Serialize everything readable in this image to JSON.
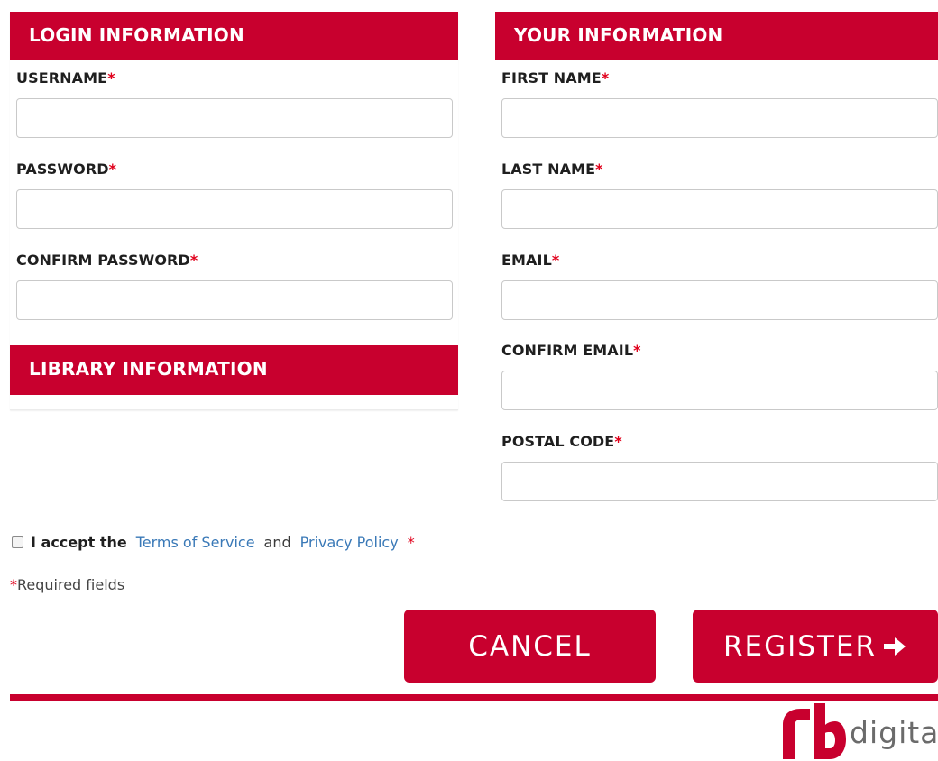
{
  "login": {
    "header": "LOGIN INFORMATION",
    "fields": [
      {
        "label": "USERNAME",
        "required_mark": "*",
        "value": ""
      },
      {
        "label": "PASSWORD",
        "required_mark": "*",
        "value": ""
      },
      {
        "label": "CONFIRM PASSWORD",
        "required_mark": "*",
        "value": ""
      }
    ]
  },
  "library": {
    "header": "LIBRARY INFORMATION"
  },
  "your_info": {
    "header": "YOUR INFORMATION",
    "fields": [
      {
        "label": "FIRST NAME",
        "required_mark": "*",
        "value": ""
      },
      {
        "label": "LAST NAME",
        "required_mark": "*",
        "value": ""
      },
      {
        "label": "EMAIL",
        "required_mark": "*",
        "value": ""
      },
      {
        "label": "CONFIRM EMAIL",
        "required_mark": "*",
        "value": ""
      },
      {
        "label": "POSTAL CODE",
        "required_mark": "*",
        "value": ""
      }
    ]
  },
  "terms": {
    "checked": false,
    "prefix": "I accept the",
    "tos_link": "Terms of Service",
    "and_text": "and",
    "privacy_link": "Privacy Policy",
    "required_mark": "*"
  },
  "required_note": {
    "mark": "*",
    "text": "Required fields"
  },
  "buttons": {
    "cancel": "CANCEL",
    "register": "REGISTER",
    "register_icon": "arrow-right-icon"
  },
  "brand": {
    "logo_icon": "rb-logo-icon",
    "wordmark": "digita"
  },
  "colors": {
    "brand_red": "#c8002e",
    "required_red": "#e0001b",
    "link_blue": "#3a79b7",
    "logo_gray": "#6b6b6b"
  }
}
